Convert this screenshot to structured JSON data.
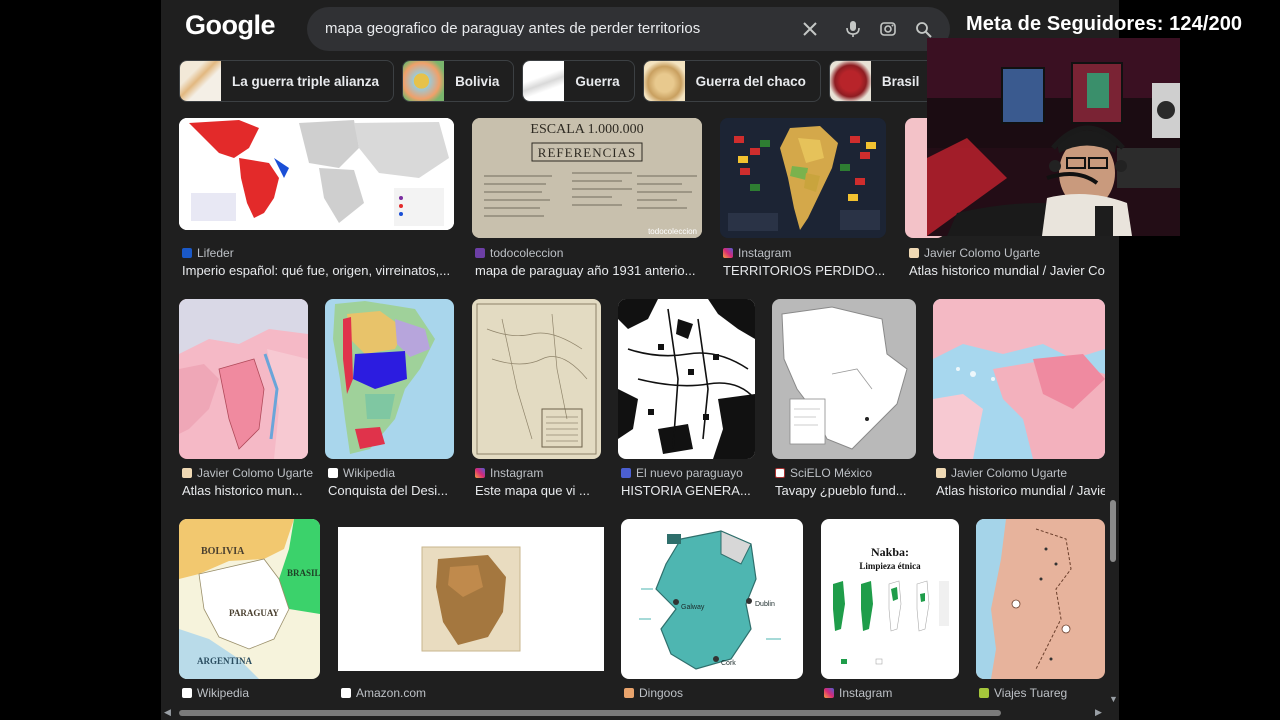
{
  "search": {
    "logo": "Google",
    "query": "mapa geografico de paraguay antes de perder territorios"
  },
  "chips": [
    {
      "label": "La guerra triple alianza"
    },
    {
      "label": "Bolivia"
    },
    {
      "label": "Guerra"
    },
    {
      "label": "Guerra del chaco"
    },
    {
      "label": "Brasil"
    }
  ],
  "rows": [
    [
      {
        "source": "Lifeder",
        "title": "Imperio español: qué fue, origen, virreinatos,..."
      },
      {
        "source": "todocoleccion",
        "title": "mapa de paraguay año 1931 anterio..."
      },
      {
        "source": "Instagram",
        "title": "TERRITORIOS PERDIDO..."
      },
      {
        "source": "Javier Colomo Ugarte",
        "title": "Atlas historico mundial / Javier Col"
      }
    ],
    [
      {
        "source": "Javier Colomo Ugarte",
        "title": "Atlas historico mun..."
      },
      {
        "source": "Wikipedia",
        "title": "Conquista del Desi..."
      },
      {
        "source": "Instagram",
        "title": "Este mapa que vi ..."
      },
      {
        "source": "El nuevo paraguayo",
        "title": "HISTORIA GENERA..."
      },
      {
        "source": "SciELO México",
        "title": "Tavapy ¿pueblo fund..."
      },
      {
        "source": "Javier Colomo Ugarte",
        "title": "Atlas historico mundial / Javie"
      }
    ],
    [
      {
        "source": "Wikipedia"
      },
      {
        "source": "Amazon.com"
      },
      {
        "source": "Dingoos"
      },
      {
        "source": "Instagram"
      },
      {
        "source": "Viajes Tuareg"
      }
    ]
  ],
  "image_text": {
    "escala": "ESCALA 1.000.000",
    "referencias": "REFERENCIAS",
    "watermark": "todocoleccion",
    "bolivia": "BOLIVIA",
    "brasil": "BRASIL",
    "paraguay": "PARAGUAY",
    "argentina": "ARGENTINA",
    "nakba_title": "Nakba:",
    "nakba_sub": "Limpieza étnica",
    "dublin": "Dublin",
    "galway": "Galway",
    "cork": "Cork"
  },
  "overlay": {
    "goal_text": "Meta de Seguidores: 124/200"
  },
  "colors": {
    "background": "#1f1f1f",
    "text": "#e8eaed",
    "muted": "#bdc1c6"
  }
}
